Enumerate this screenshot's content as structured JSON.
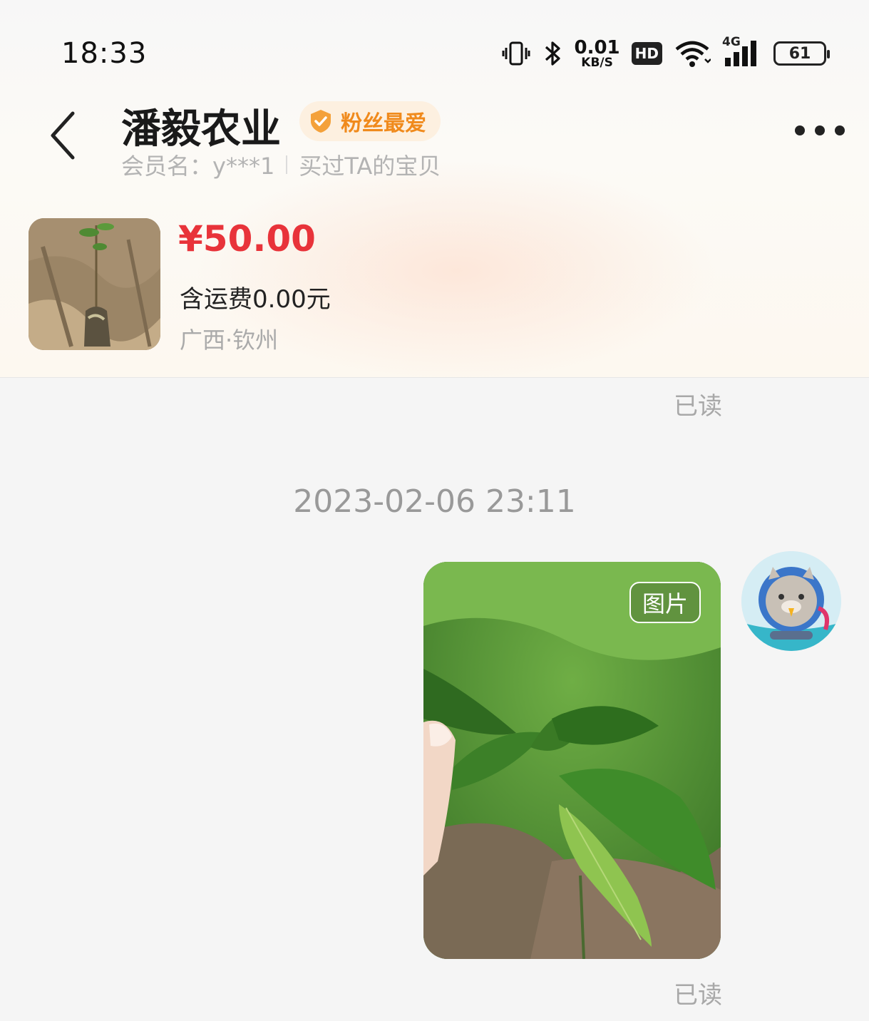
{
  "status_bar": {
    "time": "18:33",
    "net_speed_value": "0.01",
    "net_speed_unit": "KB/S",
    "hd_label": "HD",
    "network_label": "4G",
    "battery": "61"
  },
  "header": {
    "shop_name": "潘毅农业",
    "badge": "粉丝最爱",
    "member_label": "会员名：y***1",
    "bought_label": "买过TA的宝贝"
  },
  "product": {
    "price": "¥50.00",
    "shipping": "含运费0.00元",
    "location": "广西·钦州"
  },
  "chat": {
    "read_top": "已读",
    "timestamp": "2023-02-06 23:11",
    "image_tag": "图片",
    "read_bottom": "已读"
  },
  "colors": {
    "price": "#e8333a",
    "badge_text": "#f08a1c",
    "badge_bg": "#fdf0e0"
  }
}
